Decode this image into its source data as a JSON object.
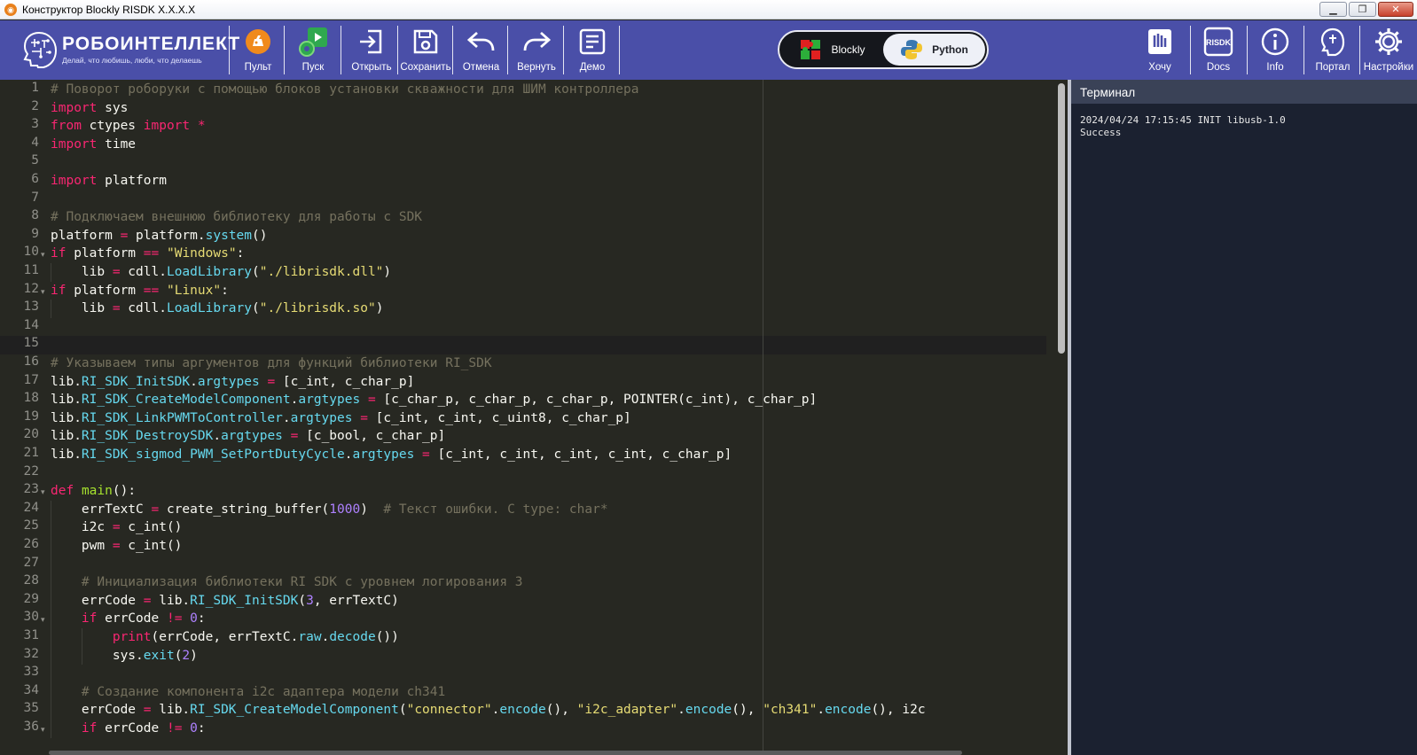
{
  "window": {
    "title": "Конструктор Blockly RISDK X.X.X.X"
  },
  "brand": {
    "name": "РОБОИНТЕЛЛЕКТ",
    "slogan": "Делай, что любишь, люби, что делаешь"
  },
  "toolbar_left": [
    {
      "id": "pult",
      "label": "Пульт",
      "icon": "remote-control-icon"
    },
    {
      "id": "run",
      "label": "Пуск",
      "icon": "run-gears-icon"
    },
    {
      "id": "open",
      "label": "Открыть",
      "icon": "open-file-icon"
    },
    {
      "id": "save",
      "label": "Сохранить",
      "icon": "save-icon"
    },
    {
      "id": "undo",
      "label": "Отмена",
      "icon": "undo-icon"
    },
    {
      "id": "redo",
      "label": "Вернуть",
      "icon": "redo-icon"
    },
    {
      "id": "demo",
      "label": "Демо",
      "icon": "demo-list-icon"
    }
  ],
  "mode_switch": {
    "blockly": "Blockly",
    "python": "Python",
    "active": "python"
  },
  "toolbar_right": [
    {
      "id": "want",
      "label": "Хочу",
      "icon": "wish-icon"
    },
    {
      "id": "docs",
      "label": "Docs",
      "icon_text": "RISDK",
      "icon": "docs-icon"
    },
    {
      "id": "info",
      "label": "Info",
      "icon": "info-icon"
    },
    {
      "id": "portal",
      "label": "Портал",
      "icon": "portal-icon"
    },
    {
      "id": "settings",
      "label": "Настройки",
      "icon": "gear-icon"
    }
  ],
  "colors": {
    "toolbar": "#4a4fa8",
    "editor_bg": "#272822",
    "terminal_bg": "#1b2130",
    "terminal_header": "#3a4257"
  },
  "editor": {
    "active_line": 15,
    "fold_lines": [
      10,
      12,
      23,
      30,
      36
    ],
    "lines": [
      [
        [
          "c",
          "# Поворот роборуки с помощью блоков установки скважности для ШИМ контроллера"
        ]
      ],
      [
        [
          "k",
          "import"
        ],
        [
          "t",
          " sys"
        ]
      ],
      [
        [
          "k",
          "from"
        ],
        [
          "t",
          " ctypes "
        ],
        [
          "k",
          "import"
        ],
        [
          "t",
          " "
        ],
        [
          "k",
          "*"
        ]
      ],
      [
        [
          "k",
          "import"
        ],
        [
          "t",
          " time"
        ]
      ],
      [],
      [
        [
          "k",
          "import"
        ],
        [
          "t",
          " platform"
        ]
      ],
      [],
      [
        [
          "c",
          "# Подключаем внешнюю библиотеку для работы с SDK"
        ]
      ],
      [
        [
          "t",
          "platform "
        ],
        [
          "k",
          "="
        ],
        [
          "t",
          " platform."
        ],
        [
          "f",
          "system"
        ],
        [
          "t",
          "()"
        ]
      ],
      [
        [
          "k",
          "if"
        ],
        [
          "t",
          " platform "
        ],
        [
          "k",
          "=="
        ],
        [
          "t",
          " "
        ],
        [
          "s",
          "\"Windows\""
        ],
        [
          "t",
          ":"
        ]
      ],
      [
        [
          "t",
          "    lib "
        ],
        [
          "k",
          "="
        ],
        [
          "t",
          " cdll."
        ],
        [
          "f",
          "LoadLibrary"
        ],
        [
          "t",
          "("
        ],
        [
          "s",
          "\"./librisdk.dll\""
        ],
        [
          "t",
          ")"
        ]
      ],
      [
        [
          "k",
          "if"
        ],
        [
          "t",
          " platform "
        ],
        [
          "k",
          "=="
        ],
        [
          "t",
          " "
        ],
        [
          "s",
          "\"Linux\""
        ],
        [
          "t",
          ":"
        ]
      ],
      [
        [
          "t",
          "    lib "
        ],
        [
          "k",
          "="
        ],
        [
          "t",
          " cdll."
        ],
        [
          "f",
          "LoadLibrary"
        ],
        [
          "t",
          "("
        ],
        [
          "s",
          "\"./librisdk.so\""
        ],
        [
          "t",
          ")"
        ]
      ],
      [],
      [],
      [
        [
          "c",
          "# Указываем типы аргументов для функций библиотеки RI_SDK"
        ]
      ],
      [
        [
          "t",
          "lib."
        ],
        [
          "f",
          "RI_SDK_InitSDK"
        ],
        [
          "t",
          "."
        ],
        [
          "f",
          "argtypes"
        ],
        [
          "t",
          " "
        ],
        [
          "k",
          "="
        ],
        [
          "t",
          " [c_int, c_char_p]"
        ]
      ],
      [
        [
          "t",
          "lib."
        ],
        [
          "f",
          "RI_SDK_CreateModelComponent"
        ],
        [
          "t",
          "."
        ],
        [
          "f",
          "argtypes"
        ],
        [
          "t",
          " "
        ],
        [
          "k",
          "="
        ],
        [
          "t",
          " [c_char_p, c_char_p, c_char_p, POINTER(c_int), c_char_p]"
        ]
      ],
      [
        [
          "t",
          "lib."
        ],
        [
          "f",
          "RI_SDK_LinkPWMToController"
        ],
        [
          "t",
          "."
        ],
        [
          "f",
          "argtypes"
        ],
        [
          "t",
          " "
        ],
        [
          "k",
          "="
        ],
        [
          "t",
          " [c_int, c_int, c_uint8, c_char_p]"
        ]
      ],
      [
        [
          "t",
          "lib."
        ],
        [
          "f",
          "RI_SDK_DestroySDK"
        ],
        [
          "t",
          "."
        ],
        [
          "f",
          "argtypes"
        ],
        [
          "t",
          " "
        ],
        [
          "k",
          "="
        ],
        [
          "t",
          " [c_bool, c_char_p]"
        ]
      ],
      [
        [
          "t",
          "lib."
        ],
        [
          "f",
          "RI_SDK_sigmod_PWM_SetPortDutyCycle"
        ],
        [
          "t",
          "."
        ],
        [
          "f",
          "argtypes"
        ],
        [
          "t",
          " "
        ],
        [
          "k",
          "="
        ],
        [
          "t",
          " [c_int, c_int, c_int, c_int, c_char_p]"
        ]
      ],
      [],
      [
        [
          "k",
          "def"
        ],
        [
          "t",
          " "
        ],
        [
          "fn",
          "main"
        ],
        [
          "t",
          "():"
        ]
      ],
      [
        [
          "t",
          "    errTextC "
        ],
        [
          "k",
          "="
        ],
        [
          "t",
          " create_string_buffer("
        ],
        [
          "n",
          "1000"
        ],
        [
          "t",
          ")  "
        ],
        [
          "c",
          "# Текст ошибки. C type: char*"
        ]
      ],
      [
        [
          "t",
          "    i2c "
        ],
        [
          "k",
          "="
        ],
        [
          "t",
          " c_int()"
        ]
      ],
      [
        [
          "t",
          "    pwm "
        ],
        [
          "k",
          "="
        ],
        [
          "t",
          " c_int()"
        ]
      ],
      [],
      [
        [
          "t",
          "    "
        ],
        [
          "c",
          "# Инициализация библиотеки RI SDK с уровнем логирования 3"
        ]
      ],
      [
        [
          "t",
          "    errCode "
        ],
        [
          "k",
          "="
        ],
        [
          "t",
          " lib."
        ],
        [
          "f",
          "RI_SDK_InitSDK"
        ],
        [
          "t",
          "("
        ],
        [
          "n",
          "3"
        ],
        [
          "t",
          ", errTextC)"
        ]
      ],
      [
        [
          "t",
          "    "
        ],
        [
          "k",
          "if"
        ],
        [
          "t",
          " errCode "
        ],
        [
          "k",
          "!="
        ],
        [
          "t",
          " "
        ],
        [
          "n",
          "0"
        ],
        [
          "t",
          ":"
        ]
      ],
      [
        [
          "t",
          "        "
        ],
        [
          "k",
          "print"
        ],
        [
          "t",
          "(errCode, errTextC."
        ],
        [
          "f",
          "raw"
        ],
        [
          "t",
          "."
        ],
        [
          "f",
          "decode"
        ],
        [
          "t",
          "())"
        ]
      ],
      [
        [
          "t",
          "        sys."
        ],
        [
          "f",
          "exit"
        ],
        [
          "t",
          "("
        ],
        [
          "n",
          "2"
        ],
        [
          "t",
          ")"
        ]
      ],
      [],
      [
        [
          "t",
          "    "
        ],
        [
          "c",
          "# Создание компонента i2c адаптера модели ch341"
        ]
      ],
      [
        [
          "t",
          "    errCode "
        ],
        [
          "k",
          "="
        ],
        [
          "t",
          " lib."
        ],
        [
          "f",
          "RI_SDK_CreateModelComponent"
        ],
        [
          "t",
          "("
        ],
        [
          "s",
          "\"connector\""
        ],
        [
          "t",
          "."
        ],
        [
          "f",
          "encode"
        ],
        [
          "t",
          "(), "
        ],
        [
          "s",
          "\"i2c_adapter\""
        ],
        [
          "t",
          "."
        ],
        [
          "f",
          "encode"
        ],
        [
          "t",
          "(), "
        ],
        [
          "s",
          "\"ch341\""
        ],
        [
          "t",
          "."
        ],
        [
          "f",
          "encode"
        ],
        [
          "t",
          "(), i2c"
        ]
      ],
      [
        [
          "t",
          "    "
        ],
        [
          "k",
          "if"
        ],
        [
          "t",
          " errCode "
        ],
        [
          "k",
          "!="
        ],
        [
          "t",
          " "
        ],
        [
          "n",
          "0"
        ],
        [
          "t",
          ":"
        ]
      ]
    ]
  },
  "terminal": {
    "title": "Терминал",
    "lines": [
      "2024/04/24 17:15:45 INIT libusb-1.0",
      "Success"
    ]
  }
}
